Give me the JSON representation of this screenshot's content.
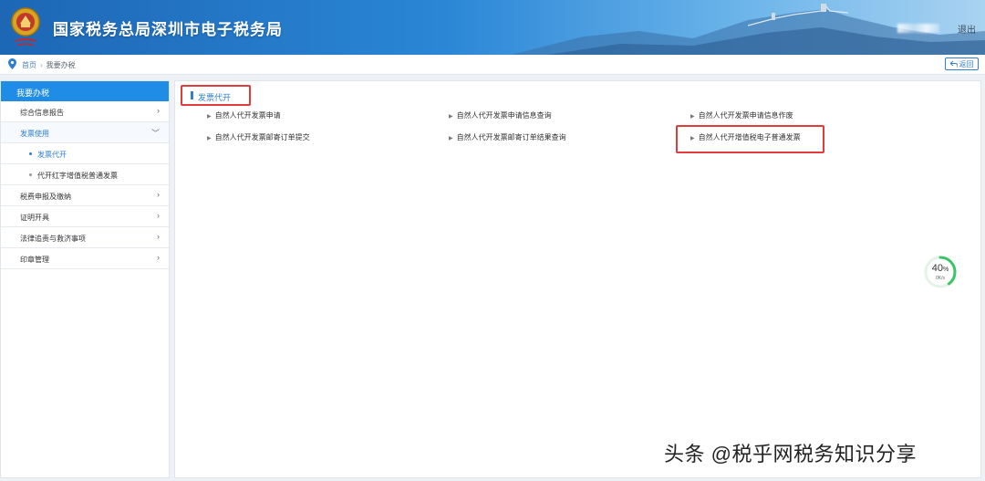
{
  "header": {
    "title": "国家税务总局深圳市电子税务局",
    "logout_label": "退出"
  },
  "breadcrumb": {
    "home": "首页",
    "separator": "›",
    "current": "我要办税",
    "back_label": "返回"
  },
  "sidebar": {
    "heading": "我要办税",
    "items": [
      {
        "label": "综合信息报告",
        "chevron": "›"
      },
      {
        "label": "发票使用",
        "chevron": "﹀"
      },
      {
        "label": "发票代开"
      },
      {
        "label": "代开红字增值税普通发票"
      },
      {
        "label": "税费申报及缴纳",
        "chevron": "›"
      },
      {
        "label": "证明开具",
        "chevron": "›"
      },
      {
        "label": "法律追责与救济事项",
        "chevron": "›"
      },
      {
        "label": "印章管理",
        "chevron": "›"
      }
    ]
  },
  "main": {
    "section_title": "发票代开",
    "links": [
      "自然人代开发票申请",
      "自然人代开发票申请信息查询",
      "自然人代开发票申请信息作废",
      "自然人代开发票邮寄订单提交",
      "自然人代开发票邮寄订单结果查询",
      "自然人代开增值税电子普通发票"
    ]
  },
  "gauge": {
    "percent": 40,
    "percent_label": "40",
    "percent_unit": "%",
    "speed": "0K/s"
  },
  "watermark": "头条 @税乎网税务知识分享",
  "colors": {
    "accent": "#2f7fd1",
    "sidebar_head": "#1f8ce6",
    "highlight": "#e23b3b",
    "gauge": "#3cc46a"
  }
}
